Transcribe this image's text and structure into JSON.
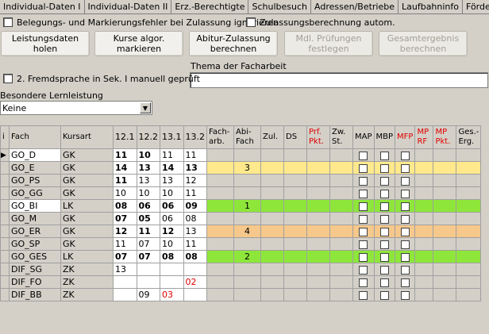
{
  "tabs": [
    "Individual-Daten I",
    "Individual-Daten II",
    "Erz.-Berechtigte",
    "Schulbesuch",
    "Adressen/Betriebe",
    "Laufbahninfo",
    "Fördermaßnahm"
  ],
  "options": {
    "ignore_errors": "Belegungs- und Markierungsfehler bei Zulassung ignorieren",
    "auto_calc": "Zulassungsberechnung autom."
  },
  "buttons": {
    "load": "Leistungsdaten holen",
    "mark": "Kurse algor. markieren",
    "calc": "Abitur-Zulassung berechnen",
    "oral": "Mdl. Prüfungen festlegen",
    "total": "Gesamtergebnis berechnen"
  },
  "second_language": "2. Fremdsprache in Sek. I manuell geprüft",
  "thesis_label": "Thema der Facharbeit",
  "thesis_value": "",
  "special_label": "Besondere Lernleistung",
  "special_value": "Keine",
  "columns": [
    "i",
    "Fach",
    "Kursart",
    "12.1",
    "12.2",
    "13.1",
    "13.2",
    "Fach-arb.",
    "Abi-Fach",
    "Zul.",
    "DS",
    "Prf. Pkt.",
    "Zw. St.",
    "MAP",
    "MBP",
    "MFP",
    "MP RF",
    "MP Pkt.",
    "Ges.-Erg."
  ],
  "rows": [
    {
      "fach": "GO_D",
      "kurs": "GK",
      "g": [
        "11",
        "10",
        "11",
        "11"
      ],
      "bold": [
        true,
        true,
        false,
        false
      ],
      "red": [
        false,
        false,
        false,
        false
      ],
      "abi": "",
      "color": ""
    },
    {
      "fach": "GO_E",
      "kurs": "GK",
      "g": [
        "14",
        "13",
        "14",
        "13"
      ],
      "bold": [
        true,
        true,
        true,
        true
      ],
      "red": [
        false,
        false,
        false,
        false
      ],
      "abi": "3",
      "color": "#ffe98c"
    },
    {
      "fach": "GO_PS",
      "kurs": "GK",
      "g": [
        "11",
        "13",
        "13",
        "12"
      ],
      "bold": [
        true,
        false,
        false,
        false
      ],
      "red": [
        false,
        false,
        false,
        false
      ],
      "abi": "",
      "color": ""
    },
    {
      "fach": "GO_GG",
      "kurs": "GK",
      "g": [
        "10",
        "10",
        "10",
        "11"
      ],
      "bold": [
        false,
        false,
        false,
        false
      ],
      "red": [
        false,
        false,
        false,
        false
      ],
      "abi": "",
      "color": ""
    },
    {
      "fach": "GO_BI",
      "kurs": "LK",
      "g": [
        "08",
        "06",
        "06",
        "09"
      ],
      "bold": [
        true,
        true,
        true,
        true
      ],
      "red": [
        false,
        false,
        false,
        false
      ],
      "abi": "1",
      "color": "#8ee63a"
    },
    {
      "fach": "GO_M",
      "kurs": "GK",
      "g": [
        "07",
        "05",
        "06",
        "08"
      ],
      "bold": [
        true,
        true,
        false,
        false
      ],
      "red": [
        false,
        false,
        false,
        false
      ],
      "abi": "",
      "color": ""
    },
    {
      "fach": "GO_ER",
      "kurs": "GK",
      "g": [
        "12",
        "11",
        "12",
        "13"
      ],
      "bold": [
        true,
        true,
        true,
        false
      ],
      "red": [
        false,
        false,
        false,
        false
      ],
      "abi": "4",
      "color": "#f6c88b"
    },
    {
      "fach": "GO_SP",
      "kurs": "GK",
      "g": [
        "11",
        "07",
        "10",
        "11"
      ],
      "bold": [
        false,
        false,
        false,
        false
      ],
      "red": [
        false,
        false,
        false,
        false
      ],
      "abi": "",
      "color": ""
    },
    {
      "fach": "GO_GES",
      "kurs": "LK",
      "g": [
        "07",
        "07",
        "08",
        "08"
      ],
      "bold": [
        true,
        true,
        true,
        true
      ],
      "red": [
        false,
        false,
        false,
        false
      ],
      "abi": "2",
      "color": "#8ee63a"
    },
    {
      "fach": "DIF_SG",
      "kurs": "ZK",
      "g": [
        "13",
        "",
        "",
        ""
      ],
      "bold": [
        false,
        false,
        false,
        false
      ],
      "red": [
        false,
        false,
        false,
        false
      ],
      "abi": "",
      "color": ""
    },
    {
      "fach": "DIF_FO",
      "kurs": "ZK",
      "g": [
        "",
        "",
        "",
        "02"
      ],
      "bold": [
        false,
        false,
        false,
        false
      ],
      "red": [
        false,
        false,
        false,
        true
      ],
      "abi": "",
      "color": ""
    },
    {
      "fach": "DIF_BB",
      "kurs": "ZK",
      "g": [
        "",
        "09",
        "03",
        ""
      ],
      "bold": [
        false,
        false,
        false,
        false
      ],
      "red": [
        false,
        false,
        true,
        false
      ],
      "abi": "",
      "color": ""
    }
  ]
}
